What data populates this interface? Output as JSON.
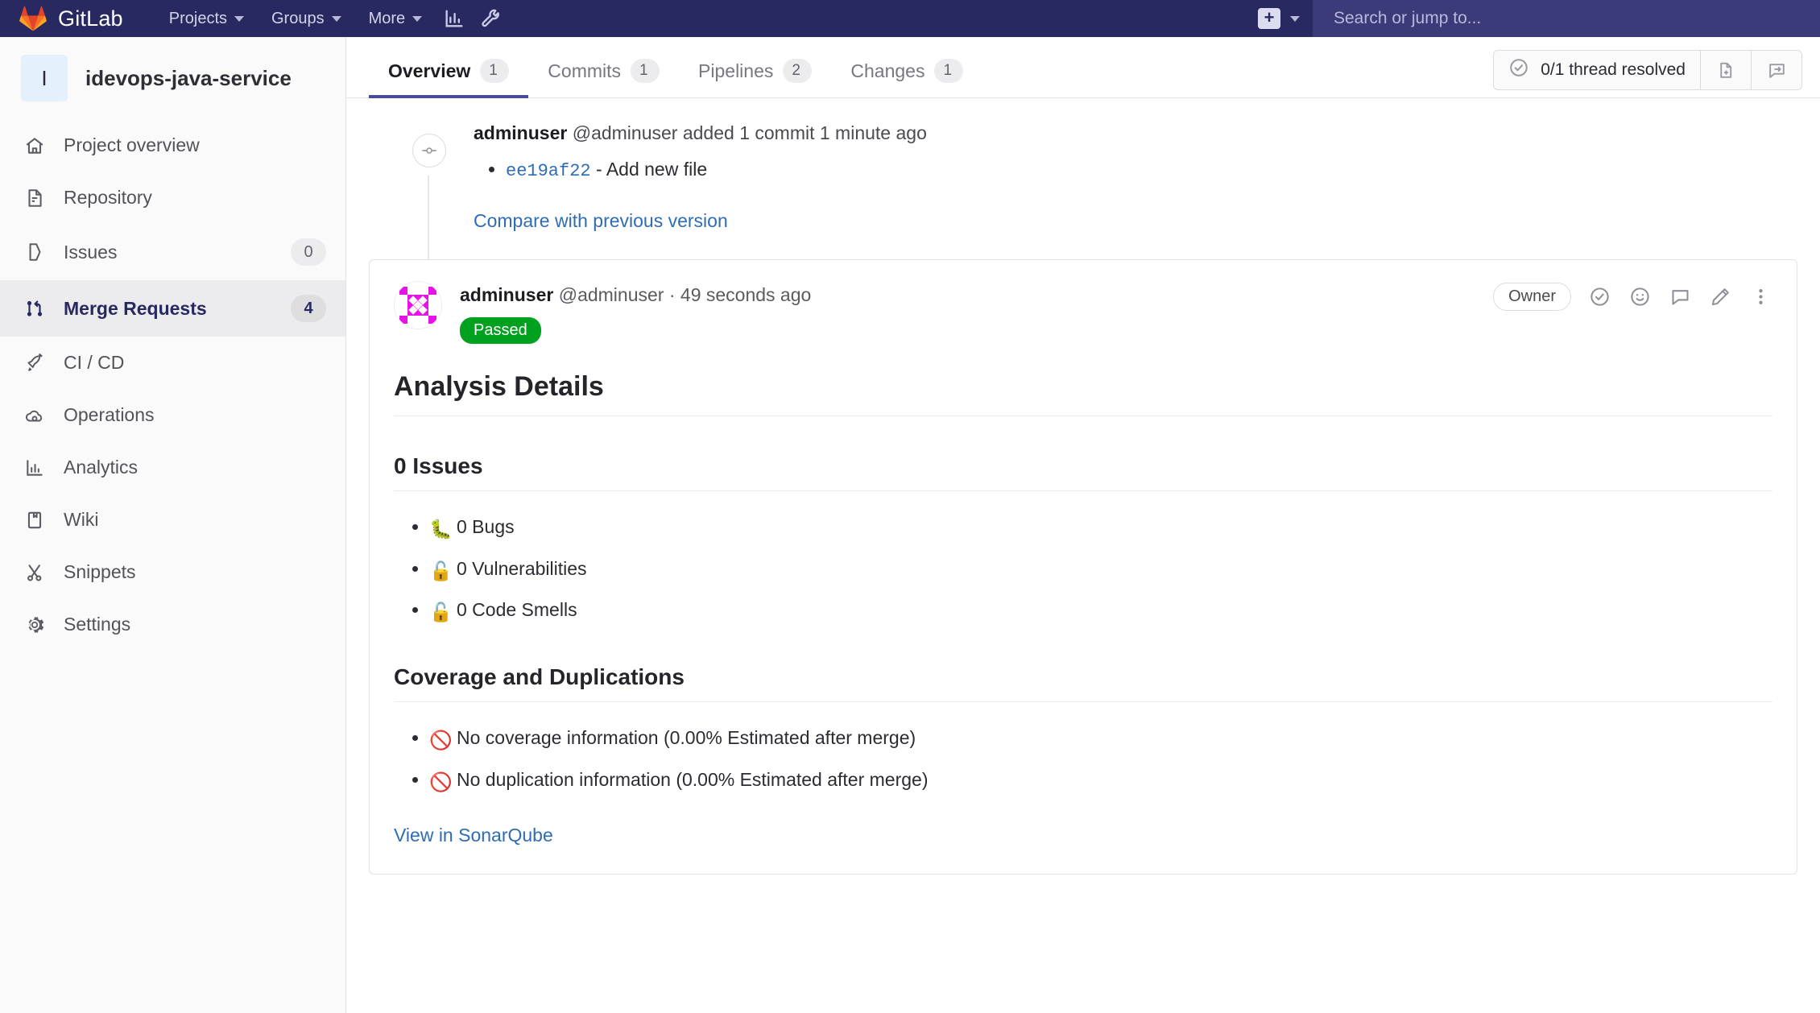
{
  "navbar": {
    "brand": "GitLab",
    "logo_icon": "gitlab-tanuki-icon",
    "links": [
      {
        "label": "Projects",
        "icon": "chevron-down-icon"
      },
      {
        "label": "Groups",
        "icon": "chevron-down-icon"
      },
      {
        "label": "More",
        "icon": "chevron-down-icon"
      }
    ],
    "icon_buttons": [
      {
        "name": "analytics-icon"
      },
      {
        "name": "wrench-icon"
      }
    ],
    "create_new": {
      "icon": "plus-icon",
      "caret": "chevron-down-icon"
    },
    "search": {
      "placeholder": "Search or jump to...",
      "value": ""
    }
  },
  "sidebar": {
    "project": {
      "avatar_initial": "I",
      "name": "idevops-java-service"
    },
    "items": [
      {
        "label": "Project overview",
        "icon": "home-icon",
        "badge": "",
        "active": false
      },
      {
        "label": "Repository",
        "icon": "document-icon",
        "badge": "",
        "active": false
      },
      {
        "label": "Issues",
        "icon": "issue-icon",
        "badge": "0",
        "active": false
      },
      {
        "label": "Merge Requests",
        "icon": "merge-request-icon",
        "badge": "4",
        "active": true
      },
      {
        "label": "CI / CD",
        "icon": "rocket-icon",
        "badge": "",
        "active": false
      },
      {
        "label": "Operations",
        "icon": "cloud-gear-icon",
        "badge": "",
        "active": false
      },
      {
        "label": "Analytics",
        "icon": "chart-icon",
        "badge": "",
        "active": false
      },
      {
        "label": "Wiki",
        "icon": "book-icon",
        "badge": "",
        "active": false
      },
      {
        "label": "Snippets",
        "icon": "scissors-icon",
        "badge": "",
        "active": false
      },
      {
        "label": "Settings",
        "icon": "gear-icon",
        "badge": "",
        "active": false
      }
    ]
  },
  "main": {
    "tabs": [
      {
        "label": "Overview",
        "badge": "1",
        "active": true
      },
      {
        "label": "Commits",
        "badge": "1",
        "active": false
      },
      {
        "label": "Pipelines",
        "badge": "2",
        "active": false
      },
      {
        "label": "Changes",
        "badge": "1",
        "active": false
      }
    ],
    "thread_widget": {
      "icon": "check-circle-icon",
      "label": "0/1 thread resolved",
      "buttons": [
        {
          "name": "create-issue-icon"
        },
        {
          "name": "jump-to-next-thread-icon"
        }
      ]
    },
    "timeline_event": {
      "dot_icon": "commit-icon",
      "author": "adminuser",
      "handle": "@adminuser",
      "action": "added 1 commit",
      "time": "1 minute ago",
      "commits": [
        {
          "sha": "ee19af22",
          "separator": "-",
          "message": "Add new file"
        }
      ],
      "compare_link": "Compare with previous version"
    },
    "note": {
      "avatar_icon": "identicon-avatar",
      "author": "adminuser",
      "handle": "@adminuser",
      "separator": "·",
      "time": "49 seconds ago",
      "status_badge": "Passed",
      "owner_badge": "Owner",
      "actions": [
        {
          "name": "resolve-thread-icon"
        },
        {
          "name": "emoji-icon"
        },
        {
          "name": "reply-comment-icon"
        },
        {
          "name": "edit-pencil-icon"
        },
        {
          "name": "more-options-icon"
        }
      ],
      "title": "Analysis Details",
      "issues_heading": "0 Issues",
      "issue_metrics": [
        {
          "icon": "bug-emoji",
          "text": "0 Bugs"
        },
        {
          "icon": "open-lock-emoji",
          "text": "0 Vulnerabilities"
        },
        {
          "icon": "open-lock-emoji",
          "text": "0 Code Smells"
        }
      ],
      "coverage_heading": "Coverage and Duplications",
      "coverage_metrics": [
        {
          "icon": "no-entry-emoji",
          "text": "No coverage information (0.00% Estimated after merge)"
        },
        {
          "icon": "no-entry-emoji",
          "text": "No duplication information (0.00% Estimated after merge)"
        }
      ],
      "view_link": "View in SonarQube"
    }
  },
  "colors": {
    "navbar_bg": "#292961",
    "accent": "#292961",
    "link": "#2e6cb5",
    "passed_green": "#00a11e",
    "sidebar_bg": "#fafafa"
  }
}
